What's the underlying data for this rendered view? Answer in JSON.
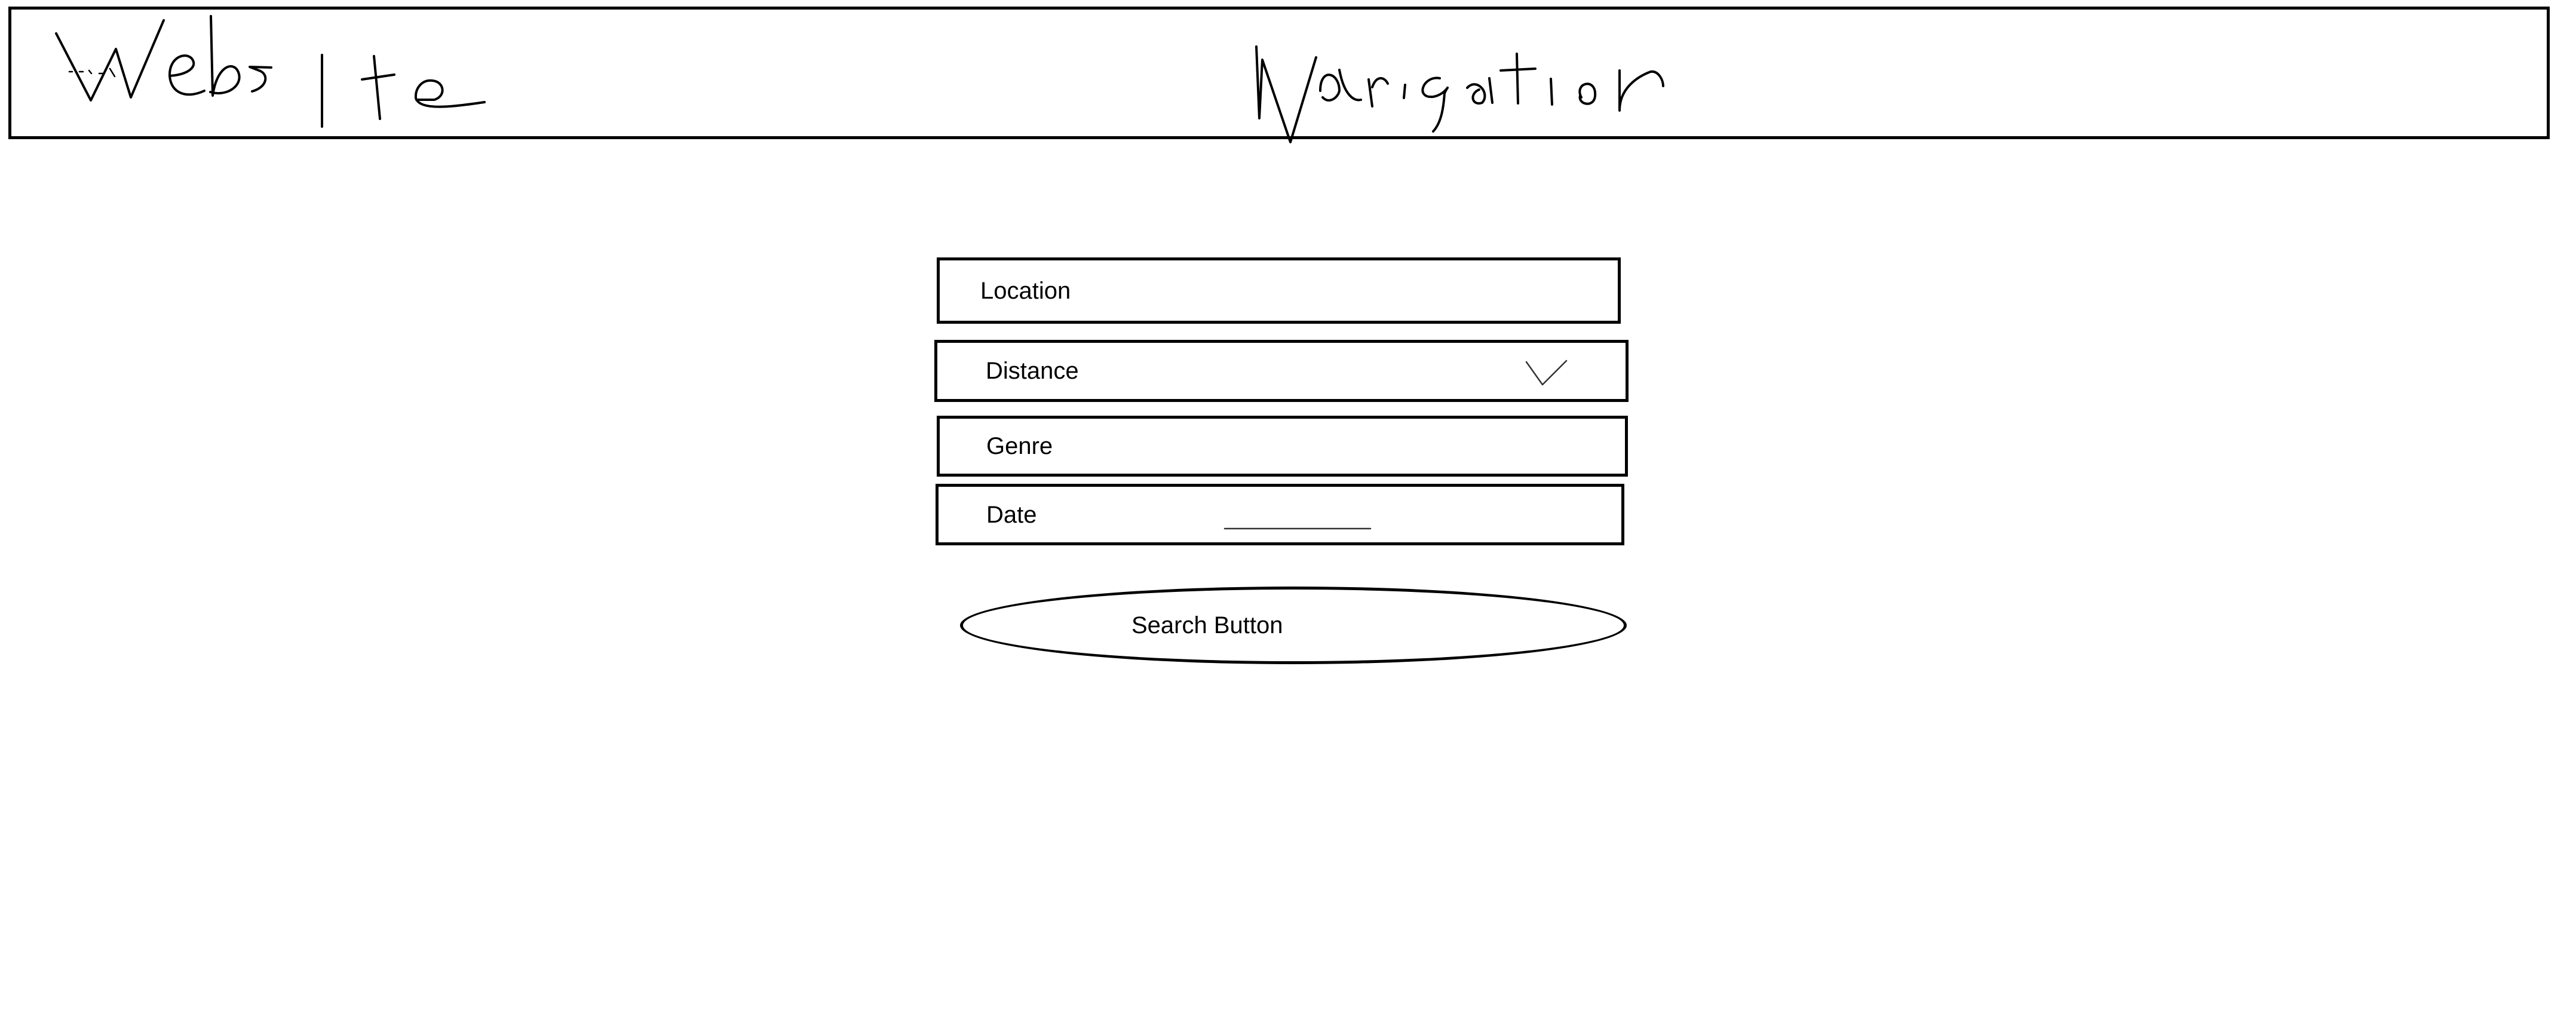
{
  "header": {
    "site_label": "Website",
    "nav_label": "Navigation"
  },
  "form": {
    "location_label": "Location",
    "distance_label": "Distance",
    "genre_label": "Genre",
    "date_label": "Date",
    "search_button_label": "Search Button"
  },
  "icons": {
    "distance_dropdown": "chevron-down-icon",
    "date_placeholder": "underline"
  }
}
